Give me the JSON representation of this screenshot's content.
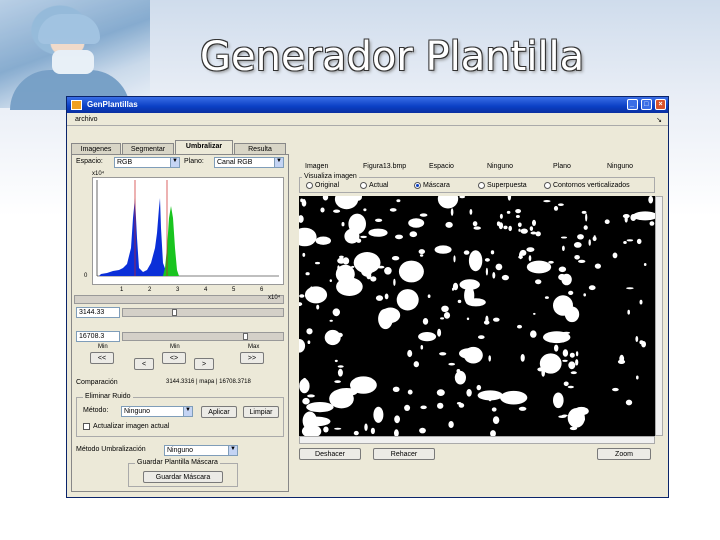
{
  "slide": {
    "title": "Generador Plantilla"
  },
  "window": {
    "title": "GenPlantillas",
    "controls": {
      "minimize": "_",
      "maximize": "□",
      "close": "×"
    }
  },
  "menu": {
    "file": "archivo",
    "arrow": "↘"
  },
  "tabs": [
    {
      "label": "Imagenes"
    },
    {
      "label": "Segmentar"
    },
    {
      "label": "Umbralizar"
    },
    {
      "label": "Resulta"
    }
  ],
  "space": {
    "label": "Espacio:",
    "value": "RGB"
  },
  "plane": {
    "label": "Plano:",
    "value": "Canal RGB"
  },
  "histogram": {
    "yexp": "x10⁴",
    "ticks": [
      "0",
      "1",
      "2",
      "3",
      "4",
      "5",
      "6"
    ],
    "xmax_label": "x10⁴"
  },
  "threshold_low": {
    "value": "3144.33",
    "fraction": 0.32
  },
  "threshold_high": {
    "value": "16708.3",
    "fraction": 0.78
  },
  "step_labels": {
    "left": "Min",
    "center": "Min",
    "right": "Max"
  },
  "buttons": {
    "prev_left": "<<",
    "next_left": "<",
    "center": "<>",
    "next_right": ">",
    "prev_right": ">>"
  },
  "compare": {
    "label": "Comparación",
    "values": "3144.3316 | mapa | 16708.3718"
  },
  "fill_group": {
    "title": "Eliminar Ruido",
    "method_label": "Método:",
    "method_value": "Ninguno",
    "apply_btn": "Aplicar",
    "undo_btn": "Limpiar",
    "check_label": "Actualizar imagen actual"
  },
  "umbral_method": {
    "label": "Método Umbralización",
    "value": "Ninguno"
  },
  "save_group": {
    "title": "Guardar Plantilla Máscara",
    "button": "Guardar Máscara"
  },
  "headers": {
    "image": "Imagen",
    "image_value": "Figura13.bmp",
    "space": "Espacio",
    "space_value": "Ninguno",
    "plane": "Plano",
    "plane_value": "Ninguno"
  },
  "view": {
    "label": "Visualiza imagen",
    "options": [
      {
        "label": "Original",
        "on": false
      },
      {
        "label": "Actual",
        "on": false
      },
      {
        "label": "Máscara",
        "on": true
      },
      {
        "label": "Superpuesta",
        "on": false
      },
      {
        "label": "Contornos verticalizados",
        "on": false
      }
    ]
  },
  "bottom_buttons": {
    "undo": "Deshacer",
    "redo": "Rehacer",
    "zoom": "Zoom"
  }
}
